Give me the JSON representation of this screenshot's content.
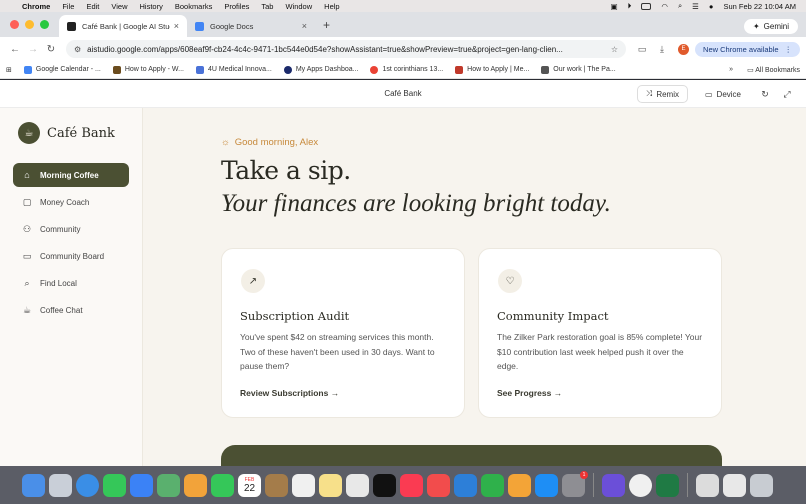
{
  "menubar": {
    "app": "Chrome",
    "items": [
      "File",
      "Edit",
      "View",
      "History",
      "Bookmarks",
      "Profiles",
      "Tab",
      "Window",
      "Help"
    ],
    "clock": "Sun Feb 22  10:04 AM"
  },
  "tabs": [
    {
      "title": "Café Bank | Google AI Studio",
      "color": "#222222"
    },
    {
      "title": "Google Docs",
      "color": "#4285f4"
    }
  ],
  "gemini_chip": "Gemini",
  "toolbar": {
    "url": "aistudio.google.com/apps/608eaf9f-cb24-4c4c-9471-1bc544e0d54e?showAssistant=true&showPreview=true&project=gen-lang-clien...",
    "profile_initial": "E",
    "update_label": "New Chrome available"
  },
  "bookmarks": [
    {
      "label": "Google Calendar - ...",
      "color": "#4285f4"
    },
    {
      "label": "How to Apply - W...",
      "color": "#6b4c1e"
    },
    {
      "label": "4U Medical Innova...",
      "color": "#4a72d8"
    },
    {
      "label": "My Apps Dashboa...",
      "color": "#1b2a6b"
    },
    {
      "label": "1st corinthians 13...",
      "color": "#ea4335"
    },
    {
      "label": "How to Apply | Me...",
      "color": "#c0392b"
    },
    {
      "label": "Our work | The Pa...",
      "color": "#555555"
    }
  ],
  "bookmarks_right": "All Bookmarks",
  "preview": {
    "title": "Café Bank",
    "remix": "Remix",
    "device": "Device"
  },
  "app": {
    "brand": "Café Bank",
    "nav": [
      {
        "label": "Morning Coffee",
        "icon": "home-icon",
        "active": true
      },
      {
        "label": "Money Coach",
        "icon": "chat-icon"
      },
      {
        "label": "Community",
        "icon": "users-icon"
      },
      {
        "label": "Community Board",
        "icon": "board-icon"
      },
      {
        "label": "Find Local",
        "icon": "search-icon"
      },
      {
        "label": "Coffee Chat",
        "icon": "coffee-icon"
      }
    ],
    "greeting": "Good morning, Alex",
    "headline": "Take a sip.",
    "subline": "Your finances are looking bright today.",
    "cards": [
      {
        "icon": "trending-up-icon",
        "title": "Subscription Audit",
        "body": "You've spent $42 on streaming services this month. Two of these haven't been used in 30 days. Want to pause them?",
        "link": "Review Subscriptions"
      },
      {
        "icon": "heart-icon",
        "title": "Community Impact",
        "body": "The Zilker Park restoration goal is 85% complete! Your $10 contribution last week helped push it over the edge.",
        "link": "See Progress"
      }
    ]
  },
  "dock": {
    "calendar_day": "22",
    "calendar_month": "FEB",
    "mail_badge": "1"
  },
  "colors": {
    "accent": "#4b5033",
    "greeting": "#c7893b",
    "background": "#f7f4ee"
  }
}
